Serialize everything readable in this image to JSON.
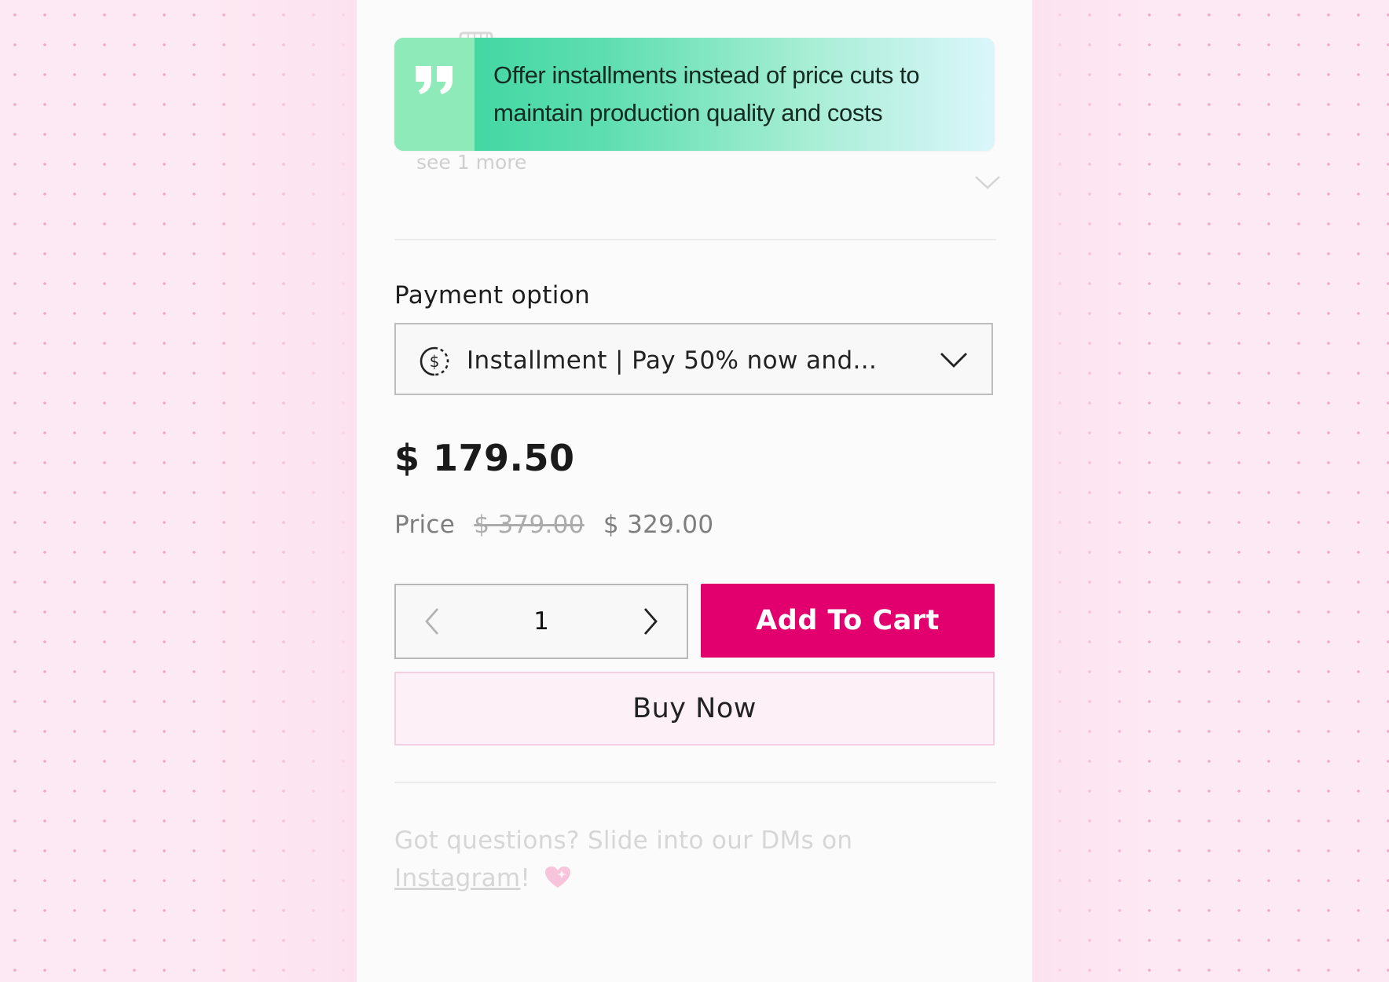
{
  "tip": {
    "text": "Offer installments instead of price cuts to maintain production quality and costs",
    "icon": "quote-icon",
    "accent": "#33d39a"
  },
  "features": {
    "see_more": "see 1 more"
  },
  "payment": {
    "label": "Payment option",
    "selected": "Installment | Pay 50% now and..."
  },
  "pricing": {
    "total": "$ 179.50",
    "price_label": "Price",
    "original_price": "$ 379.00",
    "sale_price": "$ 329.00"
  },
  "cart": {
    "quantity": "1",
    "add_to_cart": "Add To Cart",
    "buy_now": "Buy Now",
    "accent": "#e2006f"
  },
  "footer": {
    "text": "Got questions? Slide into our DMs on",
    "link": "Instagram",
    "suffix": "!"
  }
}
